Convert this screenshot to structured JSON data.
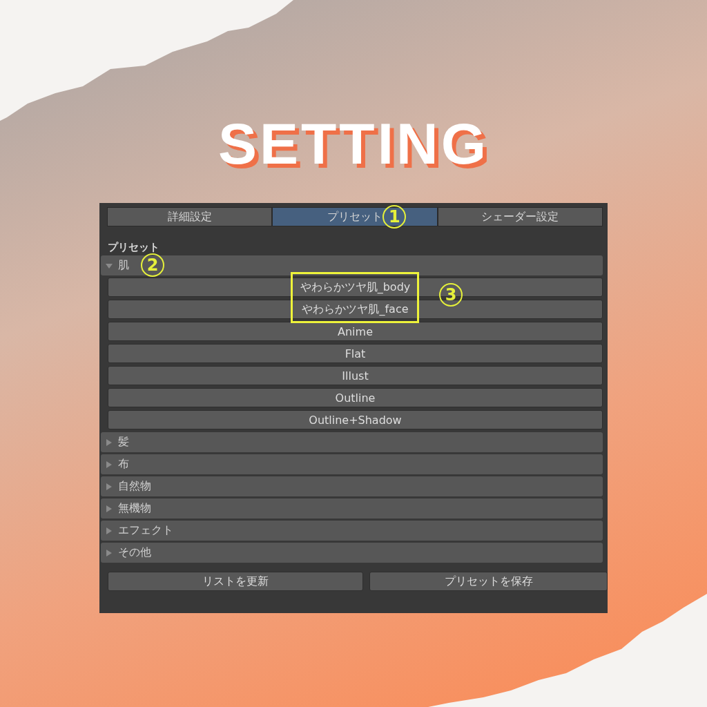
{
  "heading": "SETTING",
  "tabs": [
    {
      "label": "詳細設定",
      "selected": false
    },
    {
      "label": "プリセット",
      "selected": true,
      "annotation": "1"
    },
    {
      "label": "シェーダー設定",
      "selected": false
    }
  ],
  "section_title": "プリセット",
  "categories": [
    {
      "label": "肌",
      "expanded": true,
      "annotation": "2",
      "highlight_annotation": "3",
      "presets": [
        {
          "label": "やわらかツヤ肌_body",
          "highlighted": true
        },
        {
          "label": "やわらかツヤ肌_face",
          "highlighted": true
        },
        {
          "label": "Anime",
          "highlighted": false
        },
        {
          "label": "Flat",
          "highlighted": false
        },
        {
          "label": "Illust",
          "highlighted": false
        },
        {
          "label": "Outline",
          "highlighted": false
        },
        {
          "label": "Outline+Shadow",
          "highlighted": false
        }
      ]
    },
    {
      "label": "髪",
      "expanded": false
    },
    {
      "label": "布",
      "expanded": false
    },
    {
      "label": "自然物",
      "expanded": false
    },
    {
      "label": "無機物",
      "expanded": false
    },
    {
      "label": "エフェクト",
      "expanded": false
    },
    {
      "label": "その他",
      "expanded": false
    }
  ],
  "buttons": [
    "リストを更新",
    "プリセットを保存"
  ]
}
